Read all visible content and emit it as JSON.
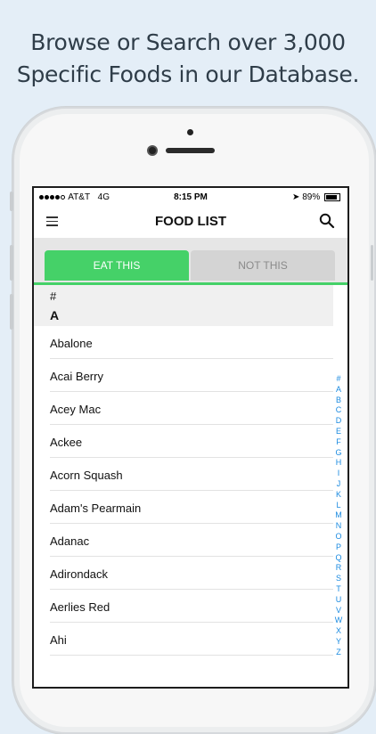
{
  "headline": {
    "line1": "Browse or Search over 3,000",
    "line2": "Specific Foods in our Database."
  },
  "status_bar": {
    "carrier": "AT&T",
    "network": "4G",
    "time": "8:15 PM",
    "battery": "89%",
    "icons": [
      "signal-dots-icon",
      "location-arrow-icon",
      "battery-icon"
    ]
  },
  "nav": {
    "title": "FOOD LIST",
    "menu_icon": "hamburger-menu-icon",
    "search_icon": "search-icon"
  },
  "tabs": [
    {
      "label": "EAT THIS",
      "active": true
    },
    {
      "label": "NOT THIS",
      "active": false
    }
  ],
  "accent_color": "#45d168",
  "index_color": "#1a8ae0",
  "sections": {
    "hash": "#",
    "a": "A"
  },
  "foods": [
    "Abalone",
    "Acai Berry",
    "Acey Mac",
    "Ackee",
    "Acorn Squash",
    "Adam's Pearmain",
    "Adanac",
    "Adirondack",
    "Aerlies Red",
    "Ahi"
  ],
  "alphabet_index": [
    "#",
    "A",
    "B",
    "C",
    "D",
    "E",
    "F",
    "G",
    "H",
    "I",
    "J",
    "K",
    "L",
    "M",
    "N",
    "O",
    "P",
    "Q",
    "R",
    "S",
    "T",
    "U",
    "V",
    "W",
    "X",
    "Y",
    "Z"
  ]
}
